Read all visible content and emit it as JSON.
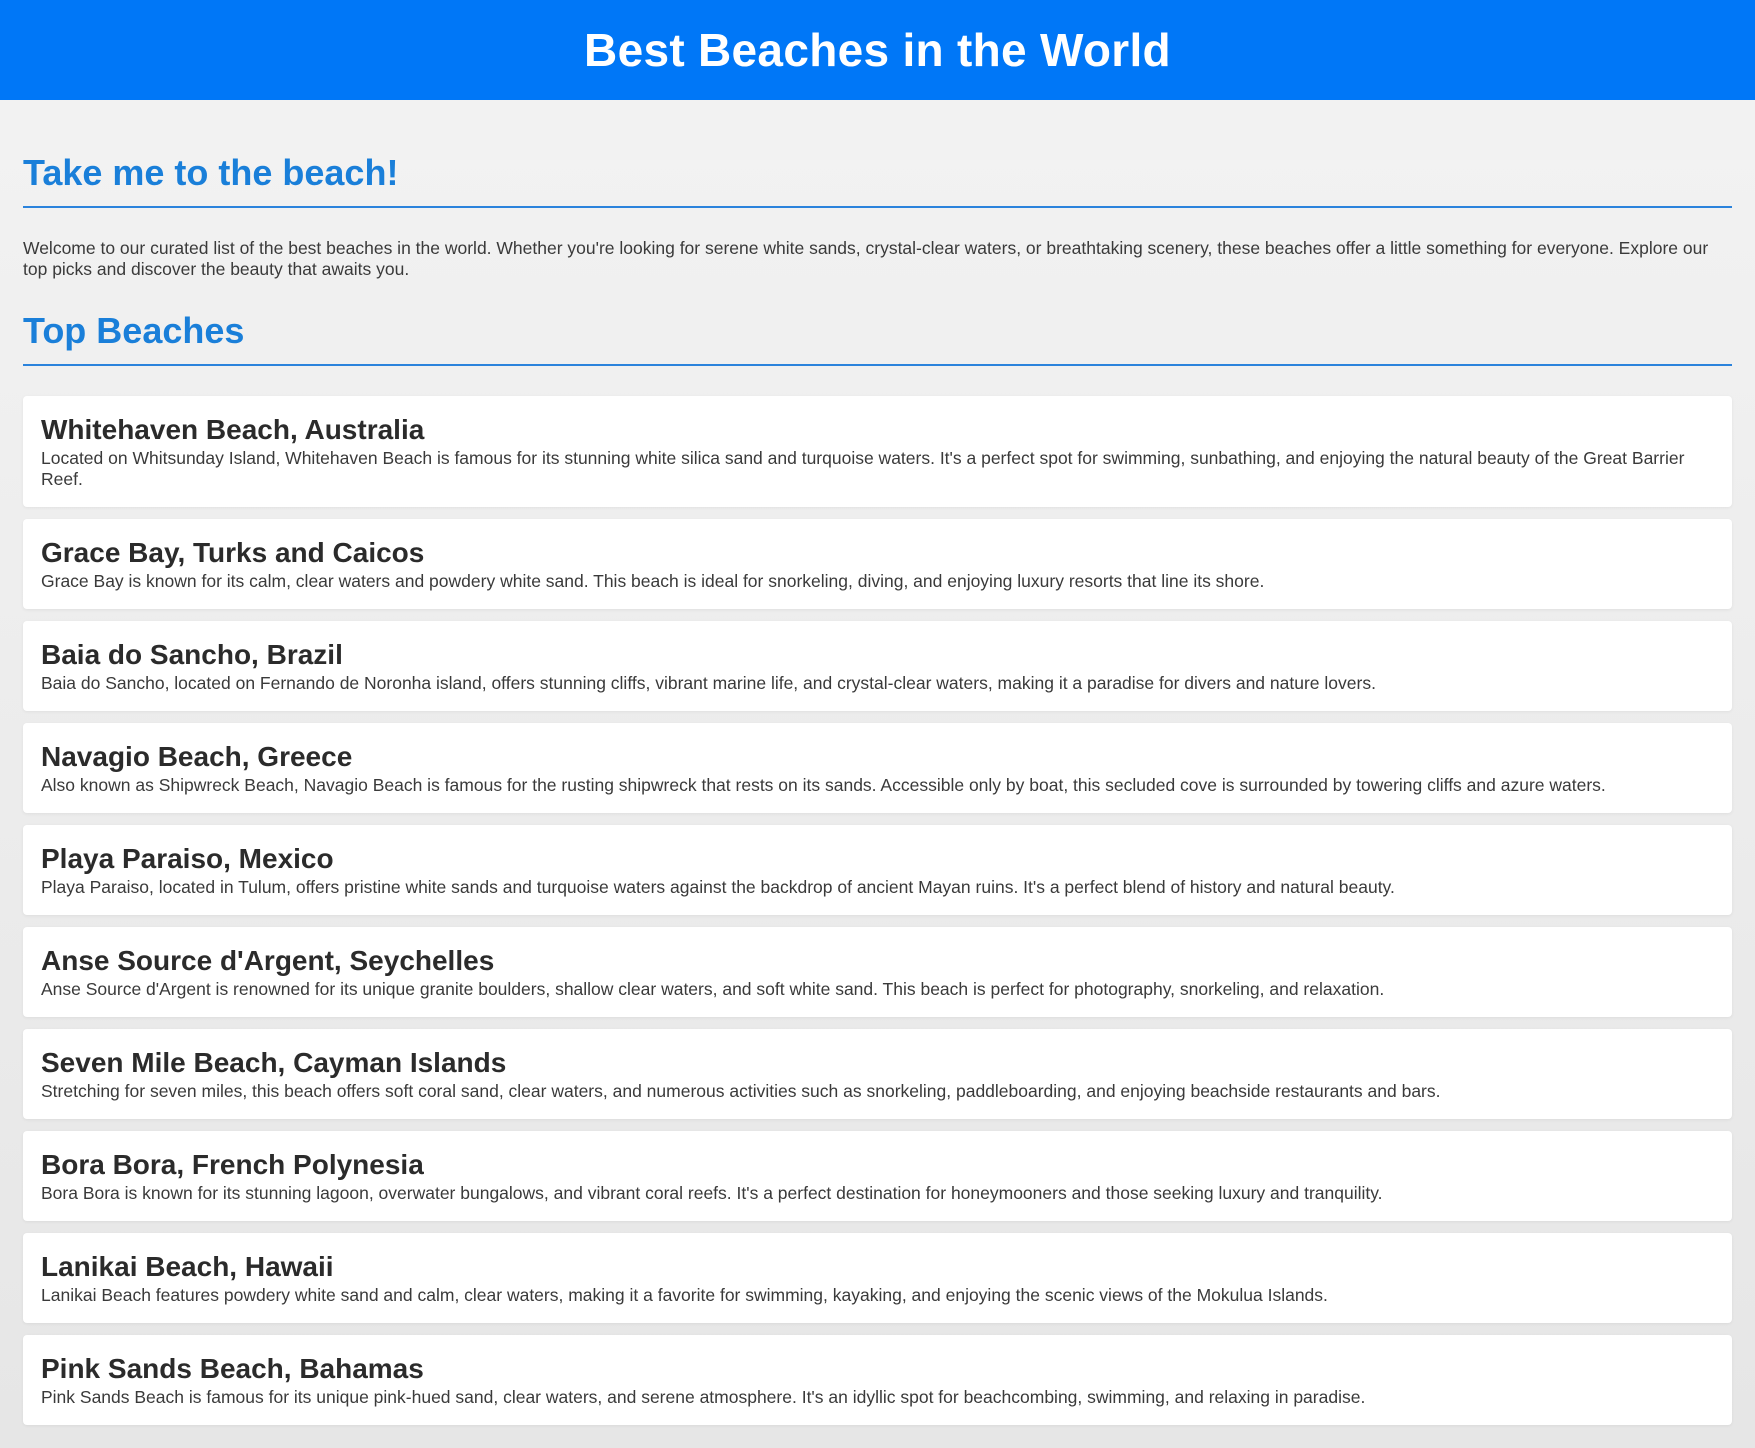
{
  "header": {
    "title": "Best Beaches in the World",
    "background_color": "#0077f7"
  },
  "intro": {
    "heading": "Take me to the beach!",
    "text": "Welcome to our curated list of the best beaches in the world. Whether you're looking for serene white sands, crystal-clear waters, or breathtaking scenery, these beaches offer a little something for everyone. Explore our top picks and discover the beauty that awaits you."
  },
  "top_beaches": {
    "heading": "Top Beaches",
    "items": [
      {
        "name": "Whitehaven Beach, Australia",
        "description": "Located on Whitsunday Island, Whitehaven Beach is famous for its stunning white silica sand and turquoise waters. It's a perfect spot for swimming, sunbathing, and enjoying the natural beauty of the Great Barrier Reef."
      },
      {
        "name": "Grace Bay, Turks and Caicos",
        "description": "Grace Bay is known for its calm, clear waters and powdery white sand. This beach is ideal for snorkeling, diving, and enjoying luxury resorts that line its shore."
      },
      {
        "name": "Baia do Sancho, Brazil",
        "description": "Baia do Sancho, located on Fernando de Noronha island, offers stunning cliffs, vibrant marine life, and crystal-clear waters, making it a paradise for divers and nature lovers."
      },
      {
        "name": "Navagio Beach, Greece",
        "description": "Also known as Shipwreck Beach, Navagio Beach is famous for the rusting shipwreck that rests on its sands. Accessible only by boat, this secluded cove is surrounded by towering cliffs and azure waters."
      },
      {
        "name": "Playa Paraiso, Mexico",
        "description": "Playa Paraiso, located in Tulum, offers pristine white sands and turquoise waters against the backdrop of ancient Mayan ruins. It's a perfect blend of history and natural beauty."
      },
      {
        "name": "Anse Source d'Argent, Seychelles",
        "description": "Anse Source d'Argent is renowned for its unique granite boulders, shallow clear waters, and soft white sand. This beach is perfect for photography, snorkeling, and relaxation."
      },
      {
        "name": "Seven Mile Beach, Cayman Islands",
        "description": "Stretching for seven miles, this beach offers soft coral sand, clear waters, and numerous activities such as snorkeling, paddleboarding, and enjoying beachside restaurants and bars."
      },
      {
        "name": "Bora Bora, French Polynesia",
        "description": "Bora Bora is known for its stunning lagoon, overwater bungalows, and vibrant coral reefs. It's a perfect destination for honeymooners and those seeking luxury and tranquility."
      },
      {
        "name": "Lanikai Beach, Hawaii",
        "description": "Lanikai Beach features powdery white sand and calm, clear waters, making it a favorite for swimming, kayaking, and enjoying the scenic views of the Mokulua Islands."
      },
      {
        "name": "Pink Sands Beach, Bahamas",
        "description": "Pink Sands Beach is famous for its unique pink-hued sand, clear waters, and serene atmosphere. It's an idyllic spot for beachcombing, swimming, and relaxing in paradise."
      }
    ]
  },
  "colors": {
    "accent": "#1a7fd9",
    "divider": "#2b83dc",
    "card_background": "#ffffff"
  }
}
